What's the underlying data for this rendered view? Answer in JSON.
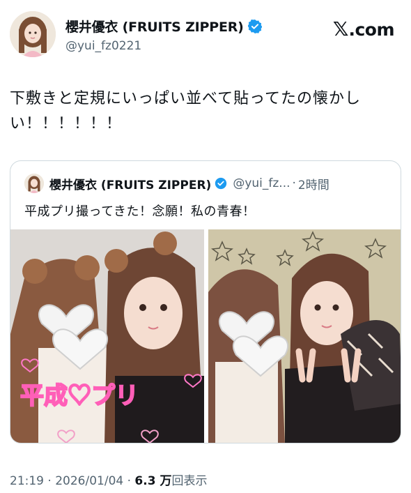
{
  "author": {
    "name": "櫻井優衣 (FRUITS ZIPPER)",
    "handle": "@yui_fz0221",
    "verified": true,
    "avatar_icon": "profile-photo-avatar"
  },
  "brand": {
    "mark": "𝕏",
    "label": ".com"
  },
  "tweet": {
    "text": "下敷きと定規にいっぱい並べて貼ってたの懐かしい！！！！！！"
  },
  "quoted": {
    "name": "櫻井優衣 (FRUITS ZIPPER)",
    "handle": "@yui_fz...",
    "dot": "·",
    "time": "2時間",
    "text": "平成プリ撮ってきた！念願！私の青春！",
    "photo_left_stamp": "平成♡プリ"
  },
  "meta": {
    "time": "21:19",
    "sep1": " · ",
    "date": "2026/01/04",
    "sep2": " · ",
    "views_count": "6.3 万",
    "views_label": "回表示"
  },
  "colors": {
    "text": "#0f1419",
    "secondary": "#536471",
    "verified_blue": "#1d9bf0",
    "border": "#cfd9de"
  }
}
